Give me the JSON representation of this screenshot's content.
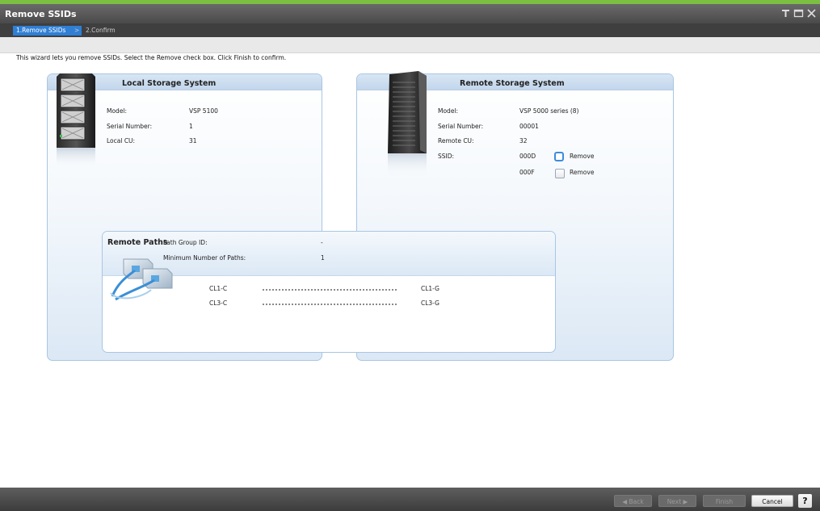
{
  "window": {
    "title": "Remove SSIDs",
    "controls": [
      "pin-icon",
      "maximize-icon",
      "close-icon"
    ]
  },
  "steps": {
    "active": "1.Remove SSIDs",
    "separator": ">",
    "next": "2.Confirm"
  },
  "instruction": "This wizard lets you remove SSIDs. Select the Remove check box. Click Finish to confirm.",
  "local": {
    "title": "Local Storage System",
    "model_label": "Model:",
    "model": "VSP 5100",
    "serial_label": "Serial Number:",
    "serial": "1",
    "cu_label": "Local CU:",
    "cu": "31"
  },
  "remote": {
    "title": "Remote Storage System",
    "model_label": "Model:",
    "model": "VSP 5000 series (8)",
    "serial_label": "Serial Number:",
    "serial": "00001",
    "cu_label": "Remote CU:",
    "cu": "32",
    "ssid_label": "SSID:",
    "ssids": [
      {
        "id": "000D",
        "remove_label": "Remove",
        "checked": false
      },
      {
        "id": "000F",
        "remove_label": "Remove",
        "checked": false
      }
    ]
  },
  "paths": {
    "title": "Remote Paths",
    "group_label": "Path Group ID:",
    "group_value": "-",
    "min_label": "Minimum Number of Paths:",
    "min_value": "1",
    "rows": [
      {
        "local": "CL1-C",
        "remote": "CL1-G"
      },
      {
        "local": "CL3-C",
        "remote": "CL3-G"
      }
    ]
  },
  "footer": {
    "back": "◀ Back",
    "next": "Next ▶",
    "finish": "Finish",
    "cancel": "Cancel",
    "help": "?"
  },
  "colors": {
    "accent": "#2f7fd4",
    "title_stripe": "#7bc043",
    "panel_border": "#a9c6e3"
  }
}
